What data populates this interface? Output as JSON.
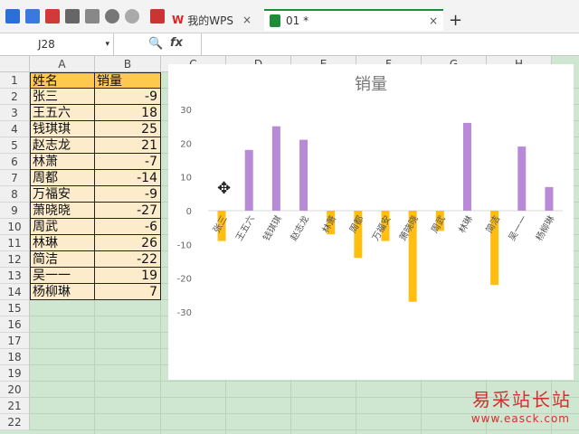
{
  "tabs": [
    {
      "label": "我的WPS",
      "close": "×"
    },
    {
      "label": "01 *",
      "close": "×"
    }
  ],
  "new_tab": "+",
  "formula_bar": {
    "cell_ref": "J28",
    "fx": "fx"
  },
  "columns": [
    "A",
    "B",
    "C",
    "D",
    "E",
    "F",
    "G",
    "H"
  ],
  "rows": [
    "1",
    "2",
    "3",
    "4",
    "5",
    "6",
    "7",
    "8",
    "9",
    "10",
    "11",
    "12",
    "13",
    "14",
    "15",
    "16",
    "17",
    "18",
    "19",
    "20",
    "21",
    "22"
  ],
  "table": {
    "headers": [
      "姓名",
      "销量"
    ],
    "rows": [
      [
        "张三",
        "-9"
      ],
      [
        "王五六",
        "18"
      ],
      [
        "钱琪琪",
        "25"
      ],
      [
        "赵志龙",
        "21"
      ],
      [
        "林萧",
        "-7"
      ],
      [
        "周都",
        "-14"
      ],
      [
        "万福安",
        "-9"
      ],
      [
        "萧晓晓",
        "-27"
      ],
      [
        "周武",
        "-6"
      ],
      [
        "林琳",
        "26"
      ],
      [
        "简洁",
        "-22"
      ],
      [
        "吴一一",
        "19"
      ],
      [
        "杨柳琳",
        "7"
      ]
    ]
  },
  "chart_data": {
    "type": "bar",
    "title": "销量",
    "categories": [
      "张三",
      "王五六",
      "钱琪琪",
      "赵志龙",
      "林萧",
      "周都",
      "万福安",
      "萧晓晓",
      "周武",
      "林琳",
      "简洁",
      "吴一一",
      "杨柳琳"
    ],
    "values": [
      -9,
      18,
      25,
      21,
      -7,
      -14,
      -9,
      -27,
      -6,
      26,
      -22,
      19,
      7
    ],
    "ylim": [
      -30,
      30
    ],
    "yticks": [
      "30",
      "20",
      "10",
      "0",
      "-10",
      "-20",
      "-30"
    ],
    "positive_color": "#b98ad8",
    "negative_color": "#ffbe10",
    "grid": false
  },
  "watermark": {
    "title": "易采站长站",
    "url": "www.easck.com"
  }
}
